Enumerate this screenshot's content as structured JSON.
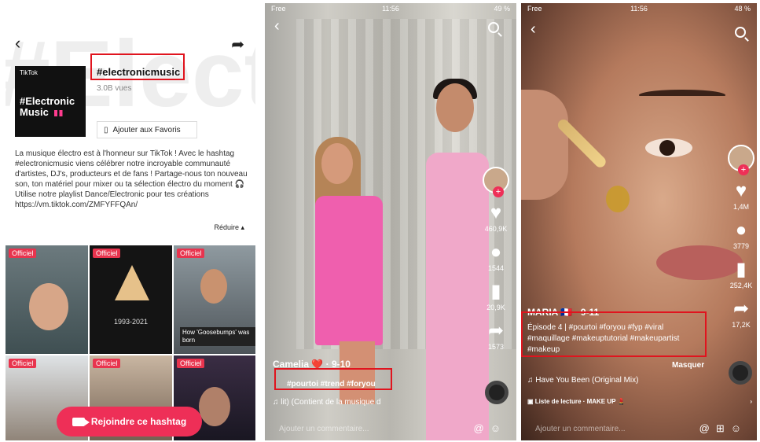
{
  "screen1": {
    "background_text": "#Elect",
    "cover_brand": "TikTok",
    "cover_title": "#Electronic Music",
    "hashtag": "#electronicmusic",
    "views": "3.0B vues",
    "favorites_button": "Ajouter aux Favoris",
    "description": "La musique électro est à l'honneur sur TikTok ! Avec le hashtag #electronicmusic viens célébrer notre incroyable communauté d'artistes, DJ's, producteurs et de fans ! Partage-nous ton nouveau son, ton matériel pour mixer ou ta sélection électro du moment 🎧 Utilise notre playlist Dance/Electronic pour tes créations https://vm.tiktok.com/ZMFYFFQAn/",
    "reduce_label": "Réduire ▴",
    "tiles": [
      {
        "badge": "Officiel",
        "caption": ""
      },
      {
        "badge": "Officiel",
        "caption": "1993-2021"
      },
      {
        "badge": "Officiel",
        "caption": "How 'Goosebumps' was born"
      },
      {
        "badge": "Officiel",
        "caption": ""
      },
      {
        "badge": "Officiel",
        "caption": ""
      },
      {
        "badge": "Officiel",
        "caption": ""
      }
    ],
    "join_button": "Rejoindre ce hashtag"
  },
  "screen2": {
    "carrier": "Free",
    "time": "11:56",
    "battery": "49 %",
    "likes": "460,9K",
    "comments": "1544",
    "saves": "20,9K",
    "shares": "1573",
    "username": "Camelia ❤️ · 9-10",
    "hashtags": "#pourtoi #trend #foryou",
    "music": "lit) (Contient de la musique d",
    "comment_placeholder": "Ajouter un commentaire..."
  },
  "screen3": {
    "carrier": "Free",
    "time": "11:56",
    "battery": "48 %",
    "likes": "1,4M",
    "comments": "3779",
    "saves": "252,4K",
    "shares": "17,2K",
    "username": "MARIA 🇫🇷 · 9-11",
    "hashtags": "Épisode 4 | #pourtoi #foryou #fyp #viral #maquillage #makeuptutorial #makeupartist #makeup",
    "masquer": "Masquer",
    "music": "Have You Been (Original Mix)",
    "playlist": "Liste de lecture · MAKE UP 💄",
    "comment_placeholder": "Ajouter un commentaire..."
  },
  "colors": {
    "highlight_box": "#e0141e",
    "tiktok_red": "#ee2f57"
  }
}
